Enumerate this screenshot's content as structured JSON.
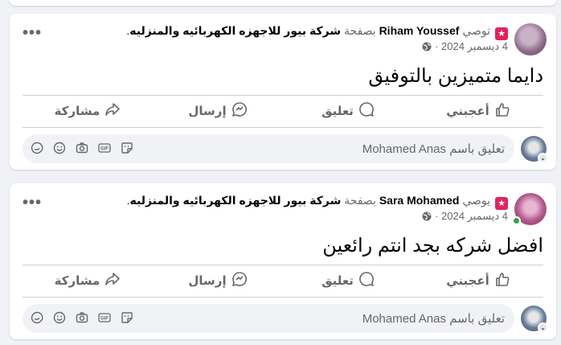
{
  "posts": [
    {
      "author": "Riham Youssef",
      "role": "توصي",
      "via": "بصفحة",
      "page": "شركة بيور للاجهزه الكهربائيه والمنزليه",
      "page_suffix": ".",
      "date": "4 ديسمبر 2024",
      "separator": "·",
      "text": "دايما متميزين بالتوفيق"
    },
    {
      "author": "Sara Mohamed",
      "role": "يوصي",
      "via": "بصفحة",
      "page": "شركة بيور للاجهزه الكهربائيه والمنزليه",
      "page_suffix": ".",
      "date": "4 ديسمبر 2024",
      "separator": "·",
      "text": "افضل شركه بجد انتم رائعين"
    }
  ],
  "actions": {
    "like": "أعجبني",
    "comment": "تعليق",
    "send": "إرسال",
    "share": "مشاركة"
  },
  "comment": {
    "placeholder": "تعليق باسم Mohamed Anas",
    "gif_label": "GIF"
  },
  "more_label": "•••",
  "badge_glyph": "★",
  "icons": [
    "recommend-badge-icon",
    "globe-icon",
    "more-icon",
    "like-icon",
    "comment-icon",
    "send-icon",
    "share-icon",
    "sticker-icon",
    "gif-icon",
    "camera-icon",
    "emoji-icon",
    "avatar-sticker-icon"
  ],
  "colors": {
    "background": "#f0f2f5",
    "card": "#ffffff",
    "text_primary": "#050505",
    "text_secondary": "#65676b",
    "recommend_badge": "#e0245e",
    "online": "#31a24c"
  }
}
